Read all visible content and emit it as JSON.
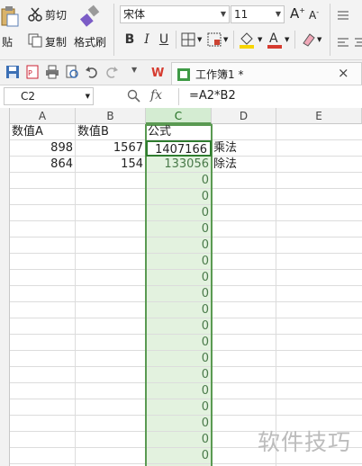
{
  "ribbon": {
    "paste_label": "贴",
    "cut_label": "剪切",
    "copy_label": "复制",
    "format_painter_label": "格式刷",
    "font_name": "宋体",
    "font_size": "11",
    "bold": "B",
    "italic": "I",
    "underline": "U",
    "grow_font": "A",
    "shrink_font": "A"
  },
  "tabs": {
    "doc_title": "工作簿1 *",
    "close_glyph": "×"
  },
  "formula_bar": {
    "name_box": "C2",
    "fx_label": "fx",
    "formula": "=A2*B2"
  },
  "grid": {
    "columns": [
      "A",
      "B",
      "C",
      "D",
      "E"
    ],
    "selected_column": "C",
    "rows": [
      {
        "a": "数值A",
        "b": "数值B",
        "c": "公式",
        "d": ""
      },
      {
        "a": "898",
        "b": "1567",
        "c": "1407166",
        "d": "乘法"
      },
      {
        "a": "864",
        "b": "154",
        "c": "133056",
        "d": "除法"
      },
      {
        "a": "",
        "b": "",
        "c": "0",
        "d": ""
      },
      {
        "a": "",
        "b": "",
        "c": "0",
        "d": ""
      },
      {
        "a": "",
        "b": "",
        "c": "0",
        "d": ""
      },
      {
        "a": "",
        "b": "",
        "c": "0",
        "d": ""
      },
      {
        "a": "",
        "b": "",
        "c": "0",
        "d": ""
      },
      {
        "a": "",
        "b": "",
        "c": "0",
        "d": ""
      },
      {
        "a": "",
        "b": "",
        "c": "0",
        "d": ""
      },
      {
        "a": "",
        "b": "",
        "c": "0",
        "d": ""
      },
      {
        "a": "",
        "b": "",
        "c": "0",
        "d": ""
      },
      {
        "a": "",
        "b": "",
        "c": "0",
        "d": ""
      },
      {
        "a": "",
        "b": "",
        "c": "0",
        "d": ""
      },
      {
        "a": "",
        "b": "",
        "c": "0",
        "d": ""
      },
      {
        "a": "",
        "b": "",
        "c": "0",
        "d": ""
      },
      {
        "a": "",
        "b": "",
        "c": "0",
        "d": ""
      },
      {
        "a": "",
        "b": "",
        "c": "0",
        "d": ""
      },
      {
        "a": "",
        "b": "",
        "c": "0",
        "d": ""
      },
      {
        "a": "",
        "b": "",
        "c": "0",
        "d": ""
      },
      {
        "a": "",
        "b": "",
        "c": "0",
        "d": ""
      }
    ]
  },
  "watermark": "软件技巧",
  "colors": {
    "selection_fill": "#e3f2df",
    "selection_border": "#5a9a52",
    "accent_red": "#d63b2f"
  }
}
